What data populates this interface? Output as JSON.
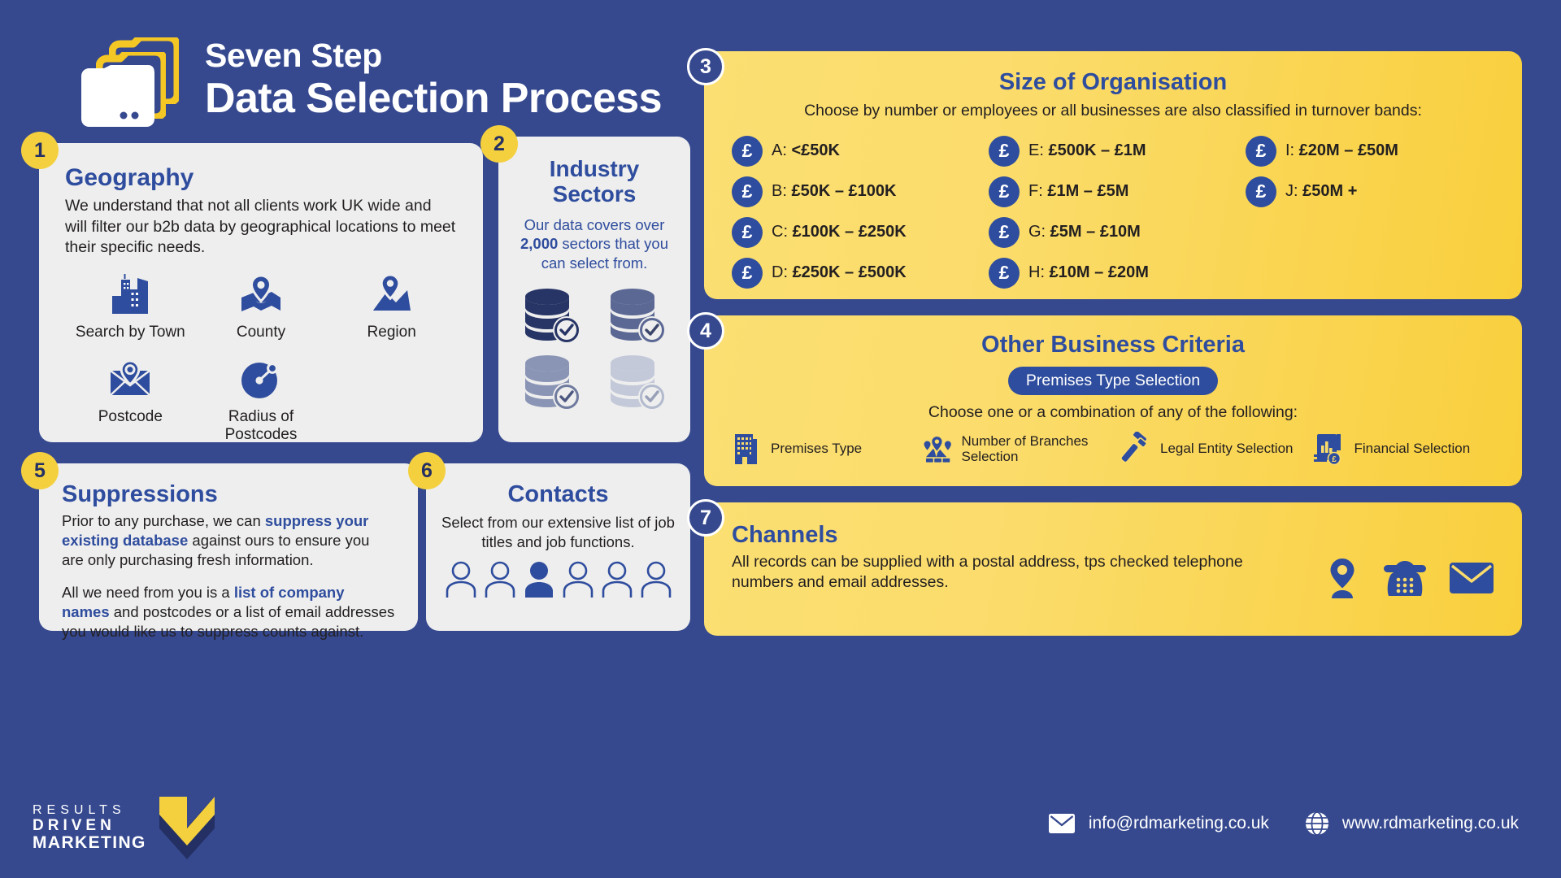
{
  "theme": {
    "bg_blue": "#36498f",
    "card_grey": "#eeeeee",
    "card_yellow": "#fbdc6b",
    "accent_blue": "#2f4d9e",
    "badge_yellow": "#f4d03f",
    "text_dark": "#231f20"
  },
  "header": {
    "title_line1": "Seven Step",
    "title_line2": "Data Selection Process",
    "logo_icon": "folders-icon"
  },
  "steps": {
    "step1": {
      "number": "1",
      "title": "Geography",
      "body": "We understand that not all clients work UK wide and will filter our b2b data by geographical locations to meet their specific needs.",
      "items": [
        {
          "icon": "city-buildings-icon",
          "label": "Search by Town"
        },
        {
          "icon": "map-pin-folded-map-icon",
          "label": "County"
        },
        {
          "icon": "map-pin-region-icon",
          "label": "Region"
        },
        {
          "icon": "postcode-envelope-pin-icon",
          "label": "Postcode"
        },
        {
          "icon": "radius-target-icon",
          "label": "Radius of Postcodes"
        }
      ]
    },
    "step2": {
      "number": "2",
      "title_line1": "Industry",
      "title_line2": "Sectors",
      "body_pre": "Our data covers over ",
      "body_bold": "2,000",
      "body_post": " sectors that you can select from.",
      "database_icons": [
        "database-check-icon",
        "database-check-icon",
        "database-check-icon",
        "database-check-icon"
      ]
    },
    "step3": {
      "number": "3",
      "title": "Size of Organisation",
      "subtitle": "Choose by number or employees or all businesses are also classified in turnover bands:",
      "bands": [
        {
          "icon": "pound-coin-icon",
          "prefix": "A: ",
          "value": "<£50K"
        },
        {
          "icon": "pound-coin-icon",
          "prefix": "B: ",
          "value": "£50K – £100K"
        },
        {
          "icon": "pound-coin-icon",
          "prefix": "C: ",
          "value": "£100K – £250K"
        },
        {
          "icon": "pound-coin-icon",
          "prefix": "D: ",
          "value": "£250K – £500K"
        },
        {
          "icon": "pound-coin-icon",
          "prefix": "E: ",
          "value": "£500K – £1M"
        },
        {
          "icon": "pound-coin-icon",
          "prefix": "F: ",
          "value": "£1M – £5M"
        },
        {
          "icon": "pound-coin-icon",
          "prefix": "G: ",
          "value": "£5M – £10M"
        },
        {
          "icon": "pound-coin-icon",
          "prefix": "H: ",
          "value": "£10M – £20M"
        },
        {
          "icon": "pound-coin-icon",
          "prefix": "I: ",
          "value": "£20M – £50M"
        },
        {
          "icon": "pound-coin-icon",
          "prefix": "J: ",
          "value": "£50M +"
        }
      ]
    },
    "step4": {
      "number": "4",
      "title": "Other Business Criteria",
      "pill": "Premises Type Selection",
      "subtitle": "Choose one or a combination of any of the following:",
      "criteria": [
        {
          "icon": "office-building-icon",
          "label": "Premises Type"
        },
        {
          "icon": "branches-map-pins-icon",
          "label": "Number of Branches Selection"
        },
        {
          "icon": "gavel-icon",
          "label": "Legal Entity Selection"
        },
        {
          "icon": "financial-document-icon",
          "label": "Financial Selection"
        }
      ]
    },
    "step5": {
      "number": "5",
      "title": "Suppressions",
      "p1_pre": "Prior to any purchase, we can ",
      "p1_bold": "suppress your existing database",
      "p1_post": " against ours to ensure you are only purchasing fresh information.",
      "p2_pre": "All we need from you is a ",
      "p2_bold": "list of company names",
      "p2_post": " and postcodes or a list of email addresses you would like us to suppress counts against."
    },
    "step6": {
      "number": "6",
      "title": "Contacts",
      "body": "Select from our extensive list of job titles and job functions.",
      "people_icons": [
        "person-outline-icon",
        "person-outline-icon",
        "person-filled-icon",
        "person-outline-icon",
        "person-outline-icon",
        "person-outline-icon"
      ]
    },
    "step7": {
      "number": "7",
      "title": "Channels",
      "body": "All records can be supplied with a postal address, tps checked telephone numbers and email addresses.",
      "channel_icons": [
        "location-pin-icon",
        "telephone-icon",
        "envelope-icon"
      ]
    }
  },
  "footer": {
    "logo_line1": "RESULTS",
    "logo_line2": "DRIVEN",
    "logo_line3": "MARKETING",
    "logo_mark": "chevron-mark-icon",
    "email_icon": "envelope-icon",
    "email": "info@rdmarketing.co.uk",
    "web_icon": "globe-icon",
    "website": "www.rdmarketing.co.uk"
  }
}
